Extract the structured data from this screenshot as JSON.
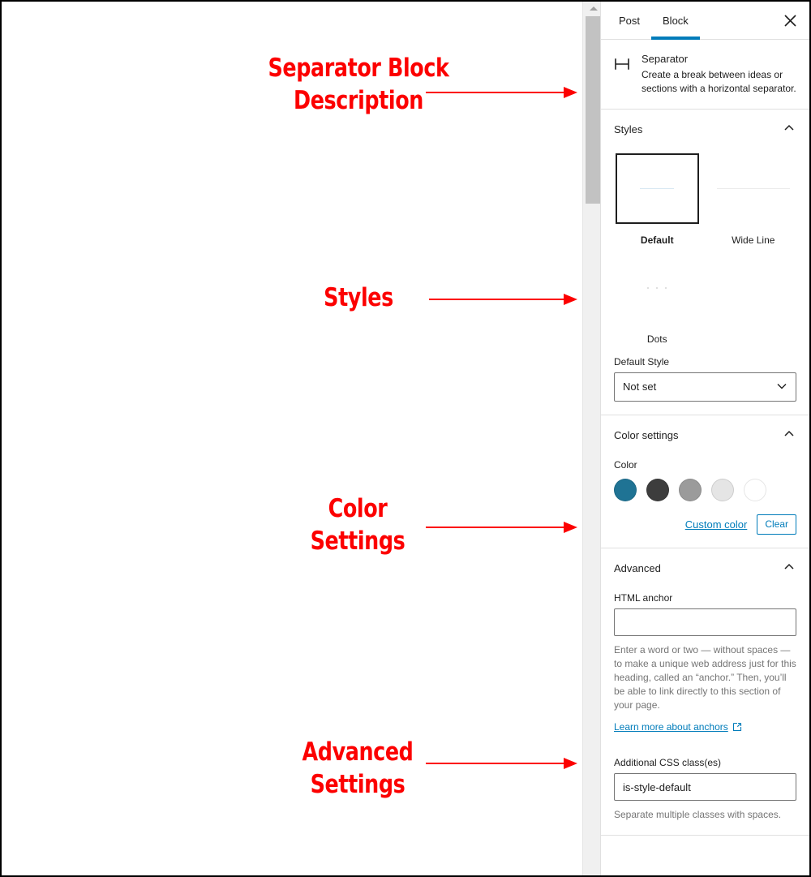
{
  "annotations": [
    {
      "id": "desc",
      "text": "Separator Block\nDescription",
      "color": "#fc0000"
    },
    {
      "id": "styles",
      "text": "Styles",
      "color": "#fc0000"
    },
    {
      "id": "color",
      "text": "Color\nSettings",
      "color": "#fc0000"
    },
    {
      "id": "advanced",
      "text": "Advanced\nSettings",
      "color": "#fc0000"
    }
  ],
  "sidebar": {
    "tabs": [
      {
        "id": "post",
        "label": "Post",
        "active": false
      },
      {
        "id": "block",
        "label": "Block",
        "active": true
      }
    ],
    "close_label": "Close settings",
    "accent_color": "#007cba",
    "block": {
      "icon": "separator-icon",
      "title": "Separator",
      "description": "Create a break between ideas or sections with a horizontal separator."
    },
    "styles_panel": {
      "title": "Styles",
      "expanded": true,
      "options": [
        {
          "id": "default",
          "label": "Default",
          "preview": "line",
          "selected": true
        },
        {
          "id": "wide-line",
          "label": "Wide Line",
          "preview": "wide",
          "selected": false
        },
        {
          "id": "dots",
          "label": "Dots",
          "preview": "dots",
          "selected": false
        }
      ],
      "default_style_label": "Default Style",
      "default_style_value": "Not set",
      "default_style_options": [
        "Not set",
        "Default",
        "Wide Line",
        "Dots"
      ]
    },
    "color_panel": {
      "title": "Color settings",
      "expanded": true,
      "color_label": "Color",
      "swatches": [
        {
          "name": "vivid-cyan-blue",
          "hex": "#1f7394"
        },
        {
          "name": "very-dark-gray",
          "hex": "#3d3d3d"
        },
        {
          "name": "cyan-bluish-gray",
          "hex": "#9b9b9b"
        },
        {
          "name": "light-gray",
          "hex": "#e5e5e5"
        },
        {
          "name": "white",
          "hex": "#ffffff"
        }
      ],
      "custom_color_label": "Custom color",
      "clear_label": "Clear"
    },
    "advanced_panel": {
      "title": "Advanced",
      "expanded": true,
      "html_anchor_label": "HTML anchor",
      "html_anchor_value": "",
      "html_anchor_placeholder": "",
      "html_anchor_help": "Enter a word or two — without spaces — to make a unique web address just for this heading, called an “anchor.” Then, you’ll be able to link directly to this section of your page.",
      "anchors_link_label": "Learn more about anchors",
      "css_classes_label": "Additional CSS class(es)",
      "css_classes_value": "is-style-default",
      "css_classes_help": "Separate multiple classes with spaces."
    }
  }
}
